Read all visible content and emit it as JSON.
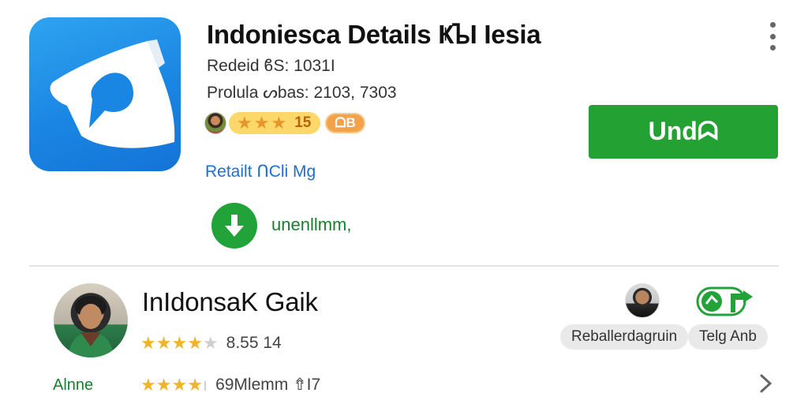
{
  "app": {
    "title": "Indoniesca Details ҜᲆI Iesia",
    "meta_1": "Redeid ϐS: 1031Ι",
    "meta_2": "Prolula ᔕbas: 2103, 7303",
    "rating_value": "15",
    "rating_stars": 3,
    "badge": "ᗝB",
    "retail_link": "Retailt ᑎCli Mg",
    "download_label": "unenllmm,",
    "install_label": "Undᗣ",
    "icon": "app-logo-icon",
    "accent_color": "#23a233",
    "link_color": "#1d6fd0"
  },
  "developer": {
    "name": "InIdonsaK Gaik",
    "side_label": "Alnne",
    "row_1": {
      "stars": 4,
      "text": "8.55 14"
    },
    "row_2": {
      "stars": 4,
      "text": "69Mlemm ⇮I7"
    },
    "chip_1": "Reballerdagruin",
    "chip_2": "Telg Anb"
  }
}
